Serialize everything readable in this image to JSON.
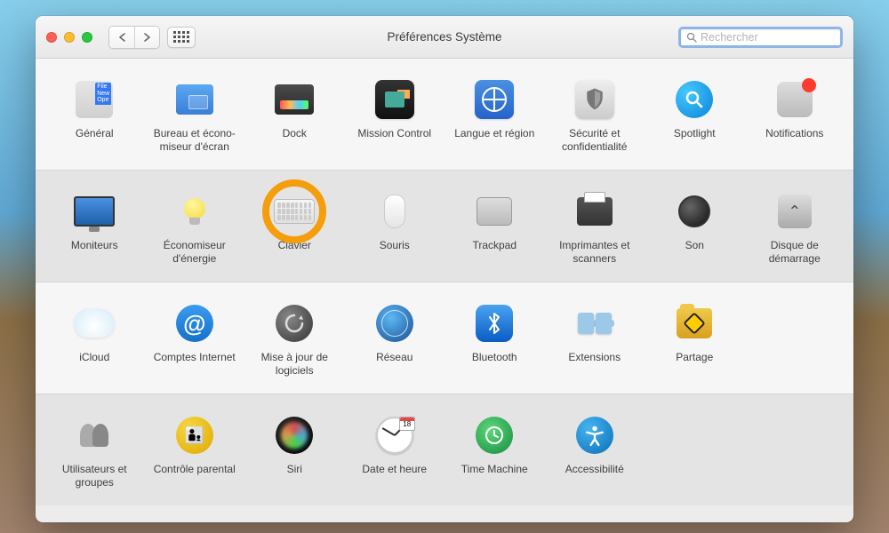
{
  "window": {
    "title": "Préférences Système",
    "search_placeholder": "Rechercher"
  },
  "highlighted": "Clavier",
  "rows": [
    {
      "style": "light",
      "items": [
        {
          "id": "general",
          "label": "Général",
          "icon": "general-icon"
        },
        {
          "id": "desktop",
          "label": "Bureau et écono-miseur d'écran",
          "icon": "desktop-icon"
        },
        {
          "id": "dock",
          "label": "Dock",
          "icon": "dock-icon"
        },
        {
          "id": "mission",
          "label": "Mission Control",
          "icon": "mission-control-icon"
        },
        {
          "id": "language",
          "label": "Langue et région",
          "icon": "language-icon"
        },
        {
          "id": "security",
          "label": "Sécurité et confidentialité",
          "icon": "security-icon"
        },
        {
          "id": "spotlight",
          "label": "Spotlight",
          "icon": "spotlight-icon"
        },
        {
          "id": "notifications",
          "label": "Notifications",
          "icon": "notifications-icon"
        }
      ]
    },
    {
      "style": "dark",
      "items": [
        {
          "id": "displays",
          "label": "Moniteurs",
          "icon": "displays-icon"
        },
        {
          "id": "energy",
          "label": "Économiseur d'énergie",
          "icon": "energy-icon"
        },
        {
          "id": "keyboard",
          "label": "Clavier",
          "icon": "keyboard-icon",
          "highlighted": true
        },
        {
          "id": "mouse",
          "label": "Souris",
          "icon": "mouse-icon"
        },
        {
          "id": "trackpad",
          "label": "Trackpad",
          "icon": "trackpad-icon"
        },
        {
          "id": "printers",
          "label": "Imprimantes et scanners",
          "icon": "printers-icon"
        },
        {
          "id": "sound",
          "label": "Son",
          "icon": "sound-icon"
        },
        {
          "id": "startup",
          "label": "Disque de démarrage",
          "icon": "startup-disk-icon"
        }
      ]
    },
    {
      "style": "light",
      "items": [
        {
          "id": "icloud",
          "label": "iCloud",
          "icon": "icloud-icon"
        },
        {
          "id": "accounts",
          "label": "Comptes Internet",
          "icon": "internet-accounts-icon"
        },
        {
          "id": "update",
          "label": "Mise à jour de logiciels",
          "icon": "software-update-icon"
        },
        {
          "id": "network",
          "label": "Réseau",
          "icon": "network-icon"
        },
        {
          "id": "bluetooth",
          "label": "Bluetooth",
          "icon": "bluetooth-icon"
        },
        {
          "id": "extensions",
          "label": "Extensions",
          "icon": "extensions-icon"
        },
        {
          "id": "sharing",
          "label": "Partage",
          "icon": "sharing-icon"
        }
      ]
    },
    {
      "style": "dark",
      "items": [
        {
          "id": "users",
          "label": "Utilisateurs et groupes",
          "icon": "users-groups-icon"
        },
        {
          "id": "parental",
          "label": "Contrôle parental",
          "icon": "parental-controls-icon"
        },
        {
          "id": "siri",
          "label": "Siri",
          "icon": "siri-icon"
        },
        {
          "id": "datetime",
          "label": "Date et heure",
          "icon": "date-time-icon",
          "calendar_day": "18"
        },
        {
          "id": "timemachine",
          "label": "Time Machine",
          "icon": "time-machine-icon"
        },
        {
          "id": "accessibility",
          "label": "Accessibilité",
          "icon": "accessibility-icon"
        }
      ]
    }
  ]
}
